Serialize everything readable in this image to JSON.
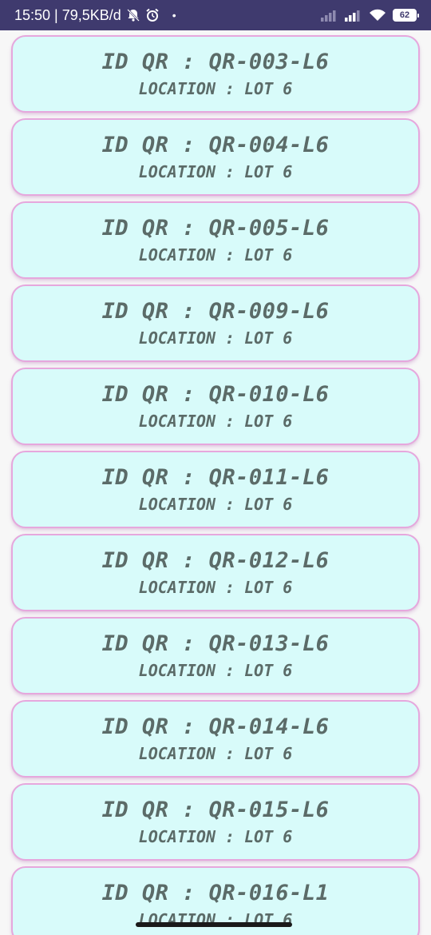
{
  "status_bar": {
    "time_speed": "15:50 | 79,5KB/d",
    "dot": "•",
    "battery_level": "62",
    "icons": [
      "mute-bell-icon",
      "alarm-clock-icon",
      "signal-icon",
      "signal-icon",
      "wifi-icon",
      "battery-icon"
    ]
  },
  "items": [
    {
      "id": "ID QR : QR-003-L6",
      "location": "LOCATION : LOT 6"
    },
    {
      "id": "ID QR : QR-004-L6",
      "location": "LOCATION : LOT 6"
    },
    {
      "id": "ID QR : QR-005-L6",
      "location": "LOCATION : LOT 6"
    },
    {
      "id": "ID QR : QR-009-L6",
      "location": "LOCATION : LOT 6"
    },
    {
      "id": "ID QR : QR-010-L6",
      "location": "LOCATION : LOT 6"
    },
    {
      "id": "ID QR : QR-011-L6",
      "location": "LOCATION : LOT 6"
    },
    {
      "id": "ID QR : QR-012-L6",
      "location": "LOCATION : LOT 6"
    },
    {
      "id": "ID QR : QR-013-L6",
      "location": "LOCATION : LOT 6"
    },
    {
      "id": "ID QR : QR-014-L6",
      "location": "LOCATION : LOT 6"
    },
    {
      "id": "ID QR : QR-015-L6",
      "location": "LOCATION : LOT 6"
    },
    {
      "id": "ID QR : QR-016-L1",
      "location": "LOCATION : LOT 6"
    }
  ]
}
